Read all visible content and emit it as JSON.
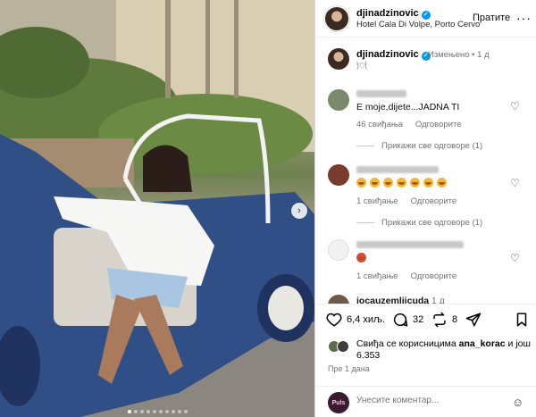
{
  "header": {
    "username": "djinadzinovic",
    "location": "Hotel Cala Di Volpe, Porto Cervo",
    "follow_label": "Пратите",
    "more_label": "···"
  },
  "caption": {
    "username": "djinadzinovic",
    "edited": "Измењено",
    "time": "1 д"
  },
  "comments": [
    {
      "text": "E moje,dijete...JADNA TI",
      "likes": "46 свиђања",
      "reply": "Одговорите",
      "view_replies": "Прикажи све одговоре (1)"
    },
    {
      "likes": "1 свиђање",
      "reply": "Одговорите",
      "view_replies": "Прикажи све одговоре (1)"
    },
    {
      "likes": "1 свиђање",
      "reply": "Одговорите"
    },
    {
      "username": "jocauzemljicuda",
      "time": "1 д"
    }
  ],
  "actions": {
    "likes_count": "6,4 хиљ.",
    "comments_count": "32",
    "reposts_count": "8"
  },
  "likes_line": {
    "prefix": "Свиђа се корисницима ",
    "user": "ana_korac",
    "suffix": " и још 6.353"
  },
  "date": "Пре 1 дана",
  "add_comment": {
    "placeholder": "Унесите коментар...",
    "logo_text": "Puls"
  },
  "colors": {
    "verified": "#0095f6",
    "meta": "#737373"
  }
}
